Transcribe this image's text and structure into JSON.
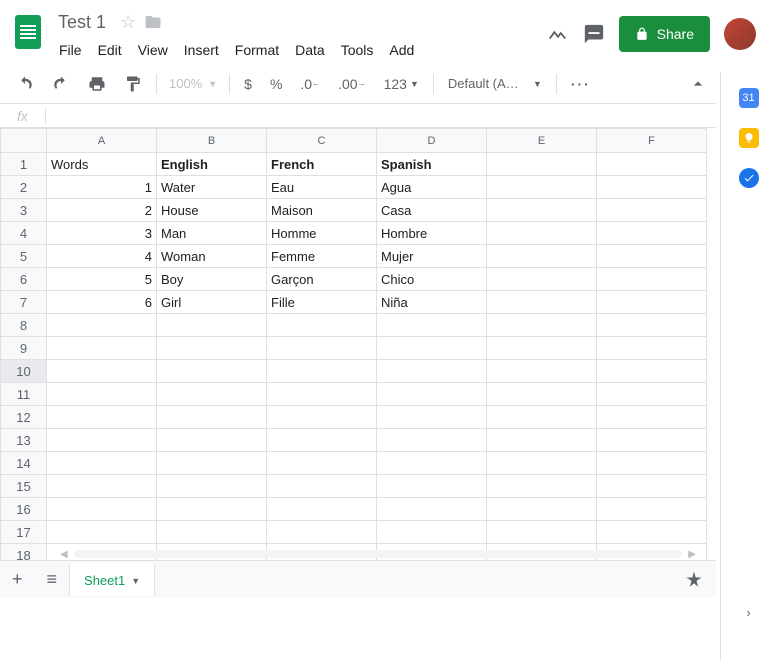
{
  "doc_title": "Test 1",
  "menus": [
    "File",
    "Edit",
    "View",
    "Insert",
    "Format",
    "Data",
    "Tools",
    "Add"
  ],
  "toolbar": {
    "zoom": "100%",
    "currency": "$",
    "percent": "%",
    "dec_dec": ".0",
    "inc_dec": ".00",
    "numfmt": "123",
    "font": "Default (Ari...",
    "more": "···"
  },
  "share_label": "Share",
  "fx_label": "fx",
  "fx_value": "",
  "columns": [
    "A",
    "B",
    "C",
    "D",
    "E",
    "F"
  ],
  "row_count": 19,
  "selected_row": 10,
  "cells": {
    "1": {
      "A": "Words",
      "B": "English",
      "C": "French",
      "D": "Spanish"
    },
    "2": {
      "A": "1",
      "B": "Water",
      "C": "Eau",
      "D": "Agua"
    },
    "3": {
      "A": "2",
      "B": "House",
      "C": "Maison",
      "D": "Casa"
    },
    "4": {
      "A": "3",
      "B": "Man",
      "C": "Homme",
      "D": "Hombre"
    },
    "5": {
      "A": "4",
      "B": "Woman",
      "C": "Femme",
      "D": "Mujer"
    },
    "6": {
      "A": "5",
      "B": "Boy",
      "C": "Garçon",
      "D": "Chico"
    },
    "7": {
      "A": "6",
      "B": "Girl",
      "C": "Fille",
      "D": "Niña"
    }
  },
  "bold_cells": [
    "1B",
    "1C",
    "1D"
  ],
  "num_cells": [
    "2A",
    "3A",
    "4A",
    "5A",
    "6A",
    "7A"
  ],
  "sheet_tab": "Sheet1"
}
